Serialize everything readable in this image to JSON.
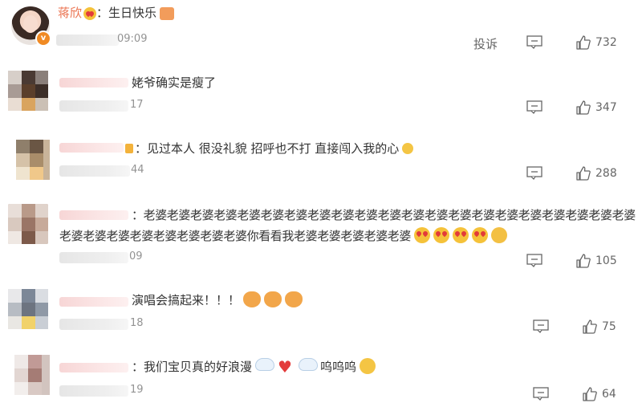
{
  "top_comment": {
    "author": "蒋欣",
    "text": "：生日快乐",
    "time": "09:09",
    "report_label": "投诉",
    "likes": "732",
    "emoji": [
      "heart-eyes-icon",
      "cake-icon"
    ]
  },
  "replies": [
    {
      "text": "姥爷确实是瘦了",
      "time": "17",
      "likes": "347"
    },
    {
      "text": "：见过本人 很没礼貌 招呼也不打 直接闯入我的心",
      "time": "44",
      "likes": "288"
    },
    {
      "text_line1": "：老婆老婆老婆老婆老婆老婆老婆老婆老婆老婆老婆老婆老婆老婆老婆老婆老婆老婆老婆老婆老婆",
      "text_line2": "老婆老婆老婆老婆老婆老婆老婆老婆你看看我老婆老婆老婆老婆老婆",
      "time": "09",
      "likes": "105"
    },
    {
      "text": "演唱会搞起来！！！",
      "time": "18",
      "likes": "75"
    },
    {
      "text": "：我们宝贝真的好浪漫",
      "text_after": "呜呜呜",
      "time": "19",
      "likes": "64"
    }
  ],
  "colors": {
    "author_name": "#eb7350",
    "meta_gray": "#939393",
    "text": "#333333"
  }
}
